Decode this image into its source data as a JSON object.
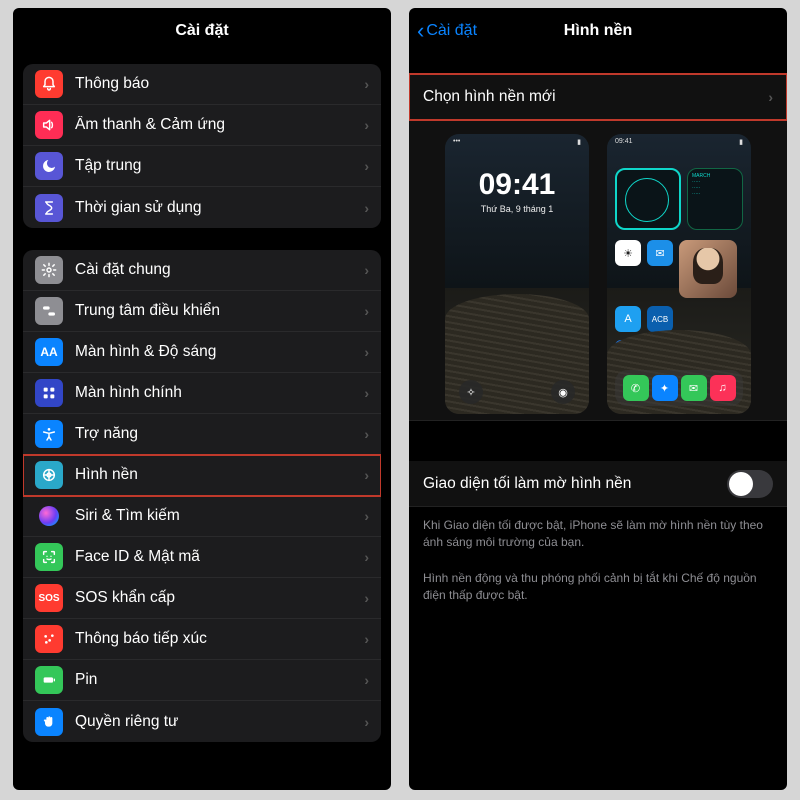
{
  "left": {
    "title": "Cài đặt",
    "groups": [
      {
        "items": [
          {
            "icon": "bell-icon",
            "color": "#ff3b30",
            "label": "Thông báo"
          },
          {
            "icon": "speaker-icon",
            "color": "#ff2d55",
            "label": "Âm thanh & Cảm ứng"
          },
          {
            "icon": "moon-icon",
            "color": "#5856d6",
            "label": "Tập trung"
          },
          {
            "icon": "hourglass-icon",
            "color": "#5856d6",
            "label": "Thời gian sử dụng"
          }
        ]
      },
      {
        "items": [
          {
            "icon": "gear-icon",
            "color": "#8e8e93",
            "label": "Cài đặt chung"
          },
          {
            "icon": "switches-icon",
            "color": "#8e8e93",
            "label": "Trung tâm điều khiển"
          },
          {
            "icon": "text-size-icon",
            "color": "#0a84ff",
            "label": "Màn hình & Độ sáng"
          },
          {
            "icon": "grid-icon",
            "color": "#3246c7",
            "label": "Màn hình chính"
          },
          {
            "icon": "accessibility-icon",
            "color": "#0a84ff",
            "label": "Trợ năng"
          },
          {
            "icon": "wallpaper-icon",
            "color": "#2aa8c9",
            "label": "Hình nền",
            "highlight": true
          },
          {
            "icon": "siri-icon",
            "color": "#1c1c1e",
            "label": "Siri & Tìm kiếm"
          },
          {
            "icon": "faceid-icon",
            "color": "#34c759",
            "label": "Face ID & Mật mã"
          },
          {
            "icon": "sos-icon",
            "color": "#ff3b30",
            "label": "SOS khẩn cấp",
            "text": "SOS"
          },
          {
            "icon": "exposure-icon",
            "color": "#ff3b30",
            "label": "Thông báo tiếp xúc"
          },
          {
            "icon": "battery-icon",
            "color": "#34c759",
            "label": "Pin"
          },
          {
            "icon": "hand-icon",
            "color": "#0a84ff",
            "label": "Quyền riêng tư"
          }
        ]
      }
    ]
  },
  "right": {
    "back_label": "Cài đặt",
    "title": "Hình nền",
    "choose_label": "Chọn hình nền mới",
    "lock_time": "09:41",
    "lock_date": "Thứ Ba, 9 tháng 1",
    "status_time": "09:41",
    "home_cal": "MARCH",
    "toggle_label": "Giao diện tối làm mờ hình nền",
    "toggle_on": false,
    "footnote1": "Khi Giao diện tối được bật, iPhone sẽ làm mờ hình nền tùy theo ánh sáng môi trường của bạn.",
    "footnote2": "Hình nền động và thu phóng phối cảnh bị tắt khi Chế độ nguồn điện thấp được bật."
  }
}
